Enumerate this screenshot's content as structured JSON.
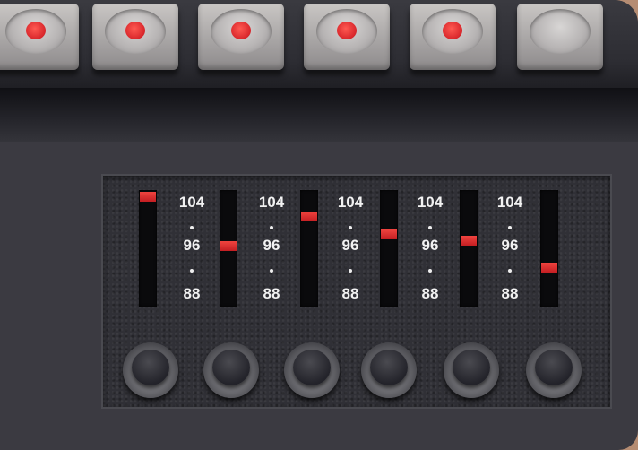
{
  "preset_buttons": [
    {
      "lit": true
    },
    {
      "lit": true
    },
    {
      "lit": true
    },
    {
      "lit": true
    },
    {
      "lit": true
    },
    {
      "lit": false
    }
  ],
  "scale_labels": {
    "top": "104",
    "middle": "96",
    "bottom": "88"
  },
  "tuning_sliders": [
    {
      "level": 0.98
    },
    {
      "level": 0.52
    },
    {
      "level": 0.8
    },
    {
      "level": 0.63
    },
    {
      "level": 0.57
    },
    {
      "level": 0.32
    }
  ],
  "knobs": [
    {
      "icon": "knob-icon"
    },
    {
      "icon": "knob-icon"
    },
    {
      "icon": "knob-icon"
    },
    {
      "icon": "knob-icon"
    },
    {
      "icon": "knob-icon"
    },
    {
      "icon": "knob-icon"
    }
  ],
  "colors": {
    "indicator": "#d8262b",
    "panel": "#303036",
    "labels": "#f2f2f2"
  }
}
